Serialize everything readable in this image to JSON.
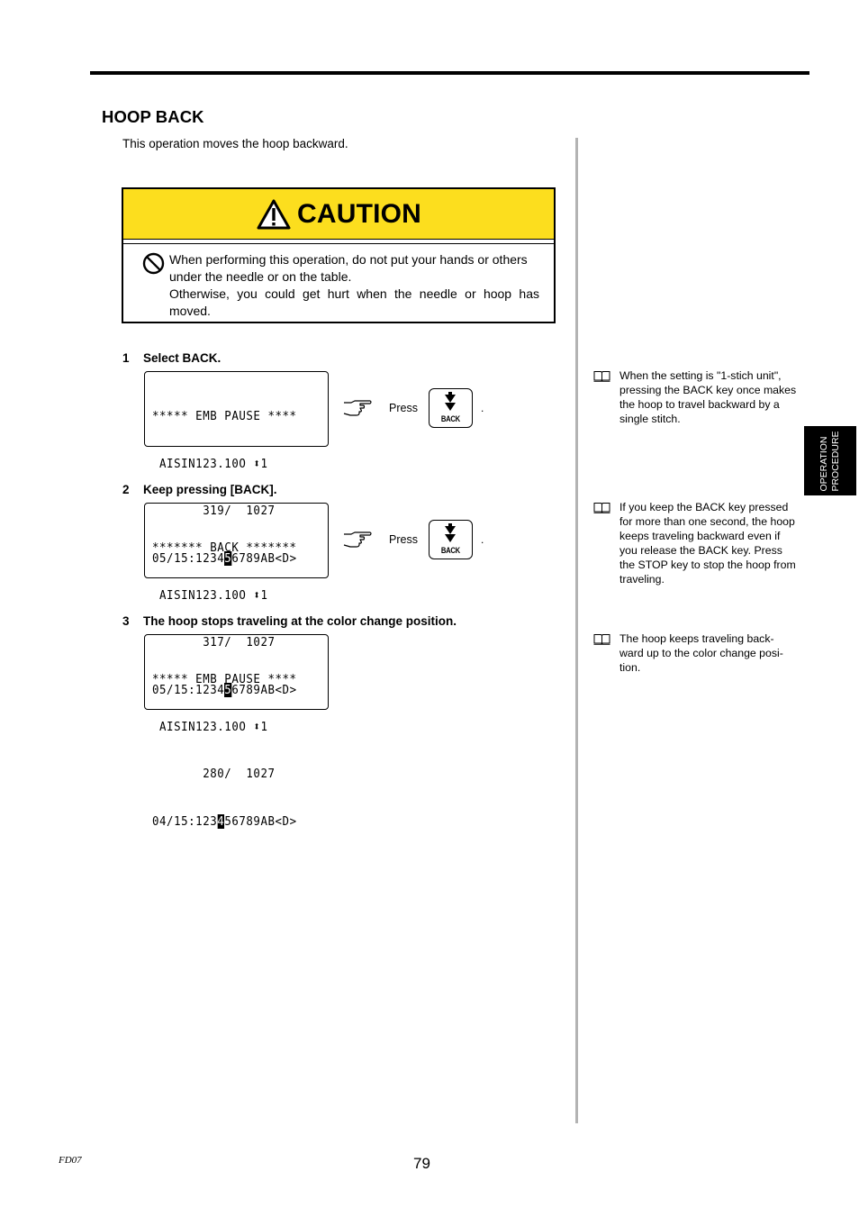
{
  "section": {
    "title": "HOOP BACK",
    "intro": "This operation moves the hoop backward."
  },
  "caution": {
    "title": "CAUTION",
    "icon": "warning-triangle-icon",
    "body_icon": "prohibition-icon",
    "line1": "When performing this operation, do not put your hands or others under the needle or on the table.",
    "line2": "Otherwise, you could get hurt when the needle or hoop has moved.",
    "header_color": "#fcde1e"
  },
  "steps": [
    {
      "number": "1",
      "label": "Select BACK.",
      "lcd": {
        "line1": "***** EMB PAUSE ****",
        "line2_pre": " AISIN123.10O ",
        "line2_arrow": "⬍",
        "line2_post": "1",
        "line3": "       319/  1027",
        "line4_pre": "05/15:1234",
        "line4_cursor": "5",
        "line4_post": "6789AB<D>"
      },
      "press_label": "Press",
      "key_label": "BACK",
      "trailing": "."
    },
    {
      "number": "2",
      "label": "Keep pressing [BACK].",
      "lcd": {
        "line1": "******* BACK *******",
        "line2_pre": " AISIN123.10O ",
        "line2_arrow": "⬍",
        "line2_post": "1",
        "line3": "       317/  1027",
        "line4_pre": "05/15:1234",
        "line4_cursor": "5",
        "line4_post": "6789AB<D>"
      },
      "press_label": "Press",
      "key_label": "BACK",
      "trailing": "."
    },
    {
      "number": "3",
      "label": "The hoop stops traveling at the color change position.",
      "lcd": {
        "line1": "***** EMB PAUSE ****",
        "line2_pre": " AISIN123.10O ",
        "line2_arrow": "⬍",
        "line2_post": "1",
        "line3": "       280/  1027",
        "line4_pre": "04/15:123",
        "line4_cursor": "4",
        "line4_post": "56789AB<D>"
      }
    }
  ],
  "notes": [
    {
      "icon": "book-icon",
      "text": "When the setting is \"1-stich unit\", pressing the BACK key once makes the hoop to travel backward by a single stitch."
    },
    {
      "icon": "book-icon",
      "text": "If you keep the BACK key pressed for more than one second, the hoop keeps traveling backward even if you release the BACK key. Press the STOP key to stop the hoop from traveling."
    },
    {
      "icon": "book-icon",
      "text": "The hoop keeps traveling back-ward up to the color change posi-tion."
    }
  ],
  "side_tab": {
    "line1": "OPERATION",
    "line2": "PROCEDURE"
  },
  "footer": {
    "code": "FD07",
    "page_number": "79"
  }
}
